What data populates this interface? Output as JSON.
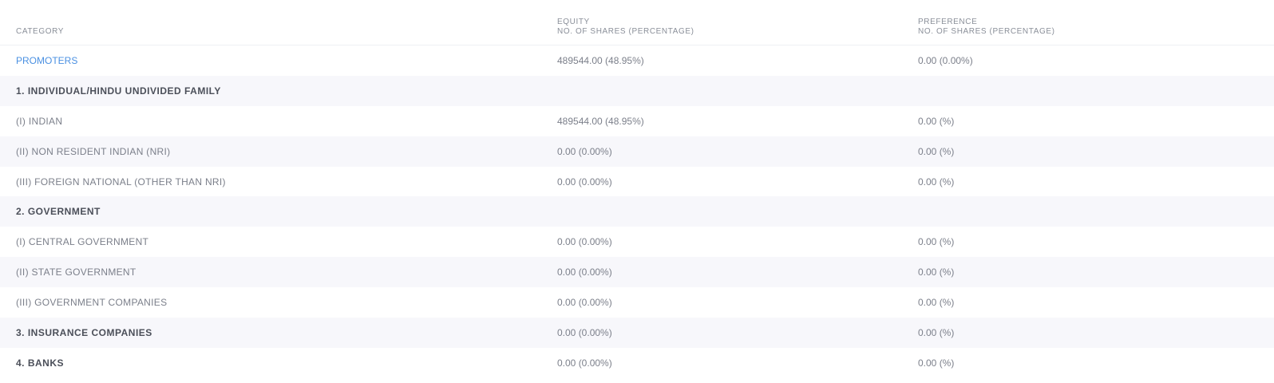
{
  "table": {
    "headers": {
      "category": "CATEGORY",
      "equity_title": "EQUITY",
      "equity_sub": "NO. OF SHARES (PERCENTAGE)",
      "preference_title": "PREFERENCE",
      "preference_sub": "NO. OF SHARES (PERCENTAGE)"
    },
    "rows": [
      {
        "category": "PROMOTERS",
        "equity": "489544.00 (48.95%)",
        "preference": "0.00 (0.00%)",
        "style": "link"
      },
      {
        "category": "1. INDIVIDUAL/HINDU UNDIVIDED FAMILY",
        "equity": "",
        "preference": "",
        "style": "section"
      },
      {
        "category": "(i) INDIAN",
        "equity": "489544.00 (48.95%)",
        "preference": "0.00 (%)",
        "style": "normal"
      },
      {
        "category": "(ii) NON RESIDENT INDIAN (NRI)",
        "equity": "0.00 (0.00%)",
        "preference": "0.00 (%)",
        "style": "normal"
      },
      {
        "category": "(iii) FOREIGN NATIONAL (OTHER THAN NRI)",
        "equity": "0.00 (0.00%)",
        "preference": "0.00 (%)",
        "style": "normal"
      },
      {
        "category": "2. GOVERNMENT",
        "equity": "",
        "preference": "",
        "style": "section"
      },
      {
        "category": "(i) CENTRAL GOVERNMENT",
        "equity": "0.00 (0.00%)",
        "preference": "0.00 (%)",
        "style": "normal"
      },
      {
        "category": "(ii) STATE GOVERNMENT",
        "equity": "0.00 (0.00%)",
        "preference": "0.00 (%)",
        "style": "normal"
      },
      {
        "category": "(iii) GOVERNMENT COMPANIES",
        "equity": "0.00 (0.00%)",
        "preference": "0.00 (%)",
        "style": "normal"
      },
      {
        "category": "3. INSURANCE COMPANIES",
        "equity": "0.00 (0.00%)",
        "preference": "0.00 (%)",
        "style": "section"
      },
      {
        "category": "4. BANKS",
        "equity": "0.00 (0.00%)",
        "preference": "0.00 (%)",
        "style": "section"
      }
    ]
  }
}
